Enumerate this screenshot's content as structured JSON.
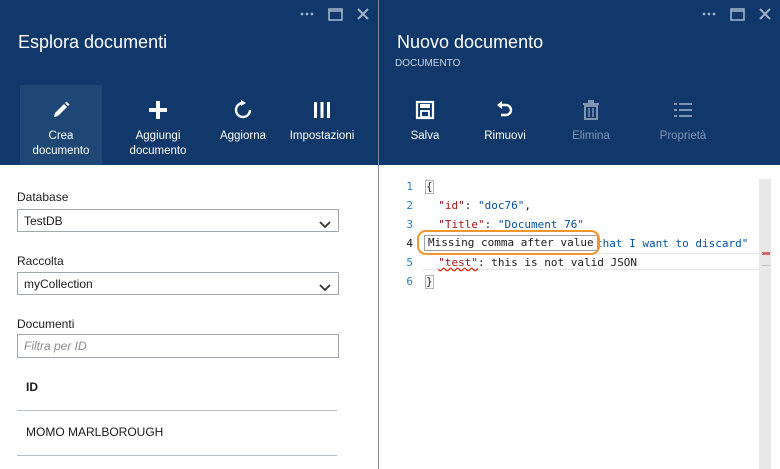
{
  "left": {
    "title": "Esplora documenti",
    "commands": [
      {
        "label": "Crea documento",
        "icon": "pencil-icon",
        "active": true
      },
      {
        "label": "Aggiungi documento",
        "icon": "plus-icon"
      },
      {
        "label": "Aggiorna",
        "icon": "refresh-icon"
      },
      {
        "label": "Impostazioni",
        "icon": "settings-columns-icon"
      }
    ],
    "database": {
      "label": "Database",
      "value": "TestDB"
    },
    "collection": {
      "label": "Raccolta",
      "value": "myCollection"
    },
    "documents": {
      "label": "Documenti",
      "filter_placeholder": "Filtra per ID",
      "column": "ID",
      "items": [
        "MOMO MARLBOROUGH"
      ]
    }
  },
  "right": {
    "title": "Nuovo documento",
    "subtitle": "DOCUMENTO",
    "commands": [
      {
        "label": "Salva",
        "icon": "save-icon",
        "enabled": true
      },
      {
        "label": "Rimuovi",
        "icon": "undo-icon",
        "enabled": true
      },
      {
        "label": "Elimina",
        "icon": "trash-icon",
        "enabled": false
      },
      {
        "label": "Proprietà",
        "icon": "list-icon",
        "enabled": false
      }
    ],
    "editor": {
      "line_numbers": [
        "1",
        "2",
        "3",
        "4",
        "5",
        "6"
      ],
      "lines": {
        "l1": "{",
        "l2_key": "\"id\"",
        "l2_sep": ": ",
        "l2_val": "\"doc76\"",
        "l2_end": ",",
        "l3_key": "\"Title\"",
        "l3_sep": ": ",
        "l3_val": "\"Document 76\"",
        "l4_visible": "that I want to discard\"",
        "l5_key": "\"test\"",
        "l5_rest": ": this is not valid JSON",
        "l6": "}"
      },
      "error_tooltip": "Missing comma after value"
    }
  },
  "colors": {
    "header": "#10386b",
    "active_command": "#1f4775",
    "highlight": "#f0962d"
  }
}
